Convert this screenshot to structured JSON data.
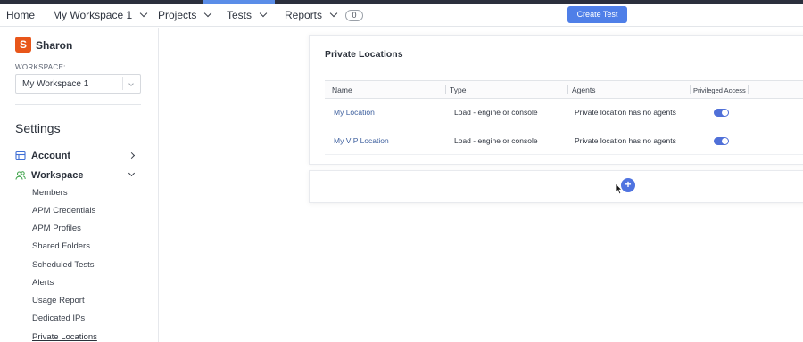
{
  "nav": {
    "home": "Home",
    "workspace": "My Workspace 1",
    "projects": "Projects",
    "tests": "Tests",
    "reports": "Reports",
    "reports_badge": "0",
    "create_test": "Create Test"
  },
  "sidebar": {
    "avatar_letter": "S",
    "username": "Sharon",
    "workspace_label": "WORKSPACE:",
    "workspace_value": "My Workspace 1",
    "settings_title": "Settings",
    "account": "Account",
    "workspace": "Workspace",
    "items": [
      "Members",
      "APM Credentials",
      "APM Profiles",
      "Shared Folders",
      "Scheduled Tests",
      "Alerts",
      "Usage Report",
      "Dedicated IPs",
      "Private Locations"
    ]
  },
  "main": {
    "title": "Private Locations",
    "columns": [
      "Name",
      "Type",
      "Agents",
      "Privileged Access"
    ],
    "rows": [
      {
        "name": "My Location",
        "type": "Load - engine or console",
        "agents": "Private location has no agents",
        "privileged": true
      },
      {
        "name": "My VIP Location",
        "type": "Load - engine or console",
        "agents": "Private location has no agents",
        "privileged": true
      }
    ],
    "add_button": "+"
  },
  "colors": {
    "accent": "#4f7fe8",
    "avatar": "#e8561a",
    "link": "#3d5f9e",
    "toggle_on": "#5070d8"
  }
}
